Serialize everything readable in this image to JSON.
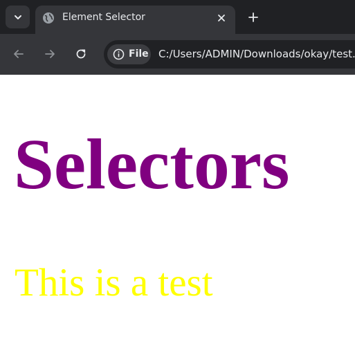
{
  "browser": {
    "tab": {
      "title": "Element Selector"
    },
    "address_bar": {
      "chip_label": "File",
      "url": "C:/Users/ADMIN/Downloads/okay/test.html"
    }
  },
  "page": {
    "heading": "Selectors",
    "paragraph": "This is a test",
    "colors": {
      "heading": "#800080",
      "paragraph": "#ffff00"
    }
  },
  "icons": {
    "tab_search": "chevron-down-icon",
    "favicon": "globe-icon",
    "tab_close": "close-icon",
    "new_tab": "plus-icon",
    "back": "arrow-left-icon",
    "forward": "arrow-right-icon",
    "reload": "reload-icon",
    "site_info": "info-icon"
  }
}
